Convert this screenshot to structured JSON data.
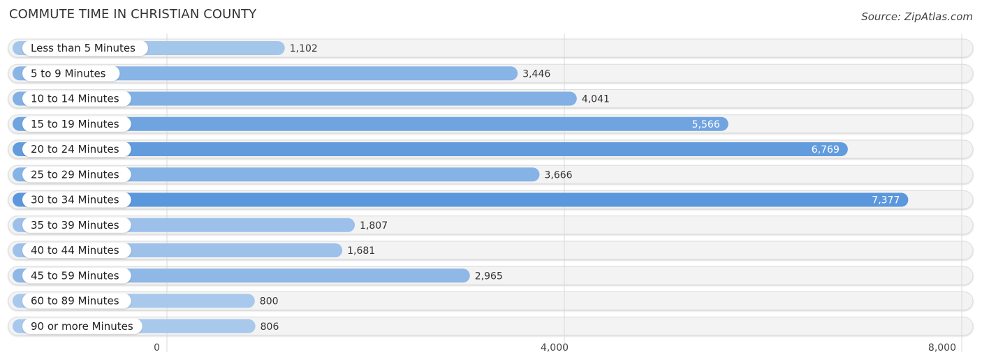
{
  "chart_data": {
    "type": "bar",
    "orientation": "horizontal",
    "title": "COMMUTE TIME IN CHRISTIAN COUNTY",
    "source": "Source: ZipAtlas.com",
    "categories": [
      "Less than 5 Minutes",
      "5 to 9 Minutes",
      "10 to 14 Minutes",
      "15 to 19 Minutes",
      "20 to 24 Minutes",
      "25 to 29 Minutes",
      "30 to 34 Minutes",
      "35 to 39 Minutes",
      "40 to 44 Minutes",
      "45 to 59 Minutes",
      "60 to 89 Minutes",
      "90 or more Minutes"
    ],
    "values": [
      1102,
      3446,
      4041,
      5566,
      6769,
      3666,
      7377,
      1807,
      1681,
      2965,
      800,
      806
    ],
    "value_labels": [
      "1,102",
      "3,446",
      "4,041",
      "5,566",
      "6,769",
      "3,666",
      "7,377",
      "1,807",
      "1,681",
      "2,965",
      "800",
      "806"
    ],
    "xlim": [
      0,
      8000
    ],
    "xticks": [
      0,
      4000,
      8000
    ],
    "xtick_labels": [
      "0",
      "4,000",
      "8,000"
    ],
    "grid": true,
    "legend": "none",
    "colors": {
      "light": "#a8c8ec",
      "dark": "#5b97dc",
      "track": "#f3f3f3"
    }
  }
}
